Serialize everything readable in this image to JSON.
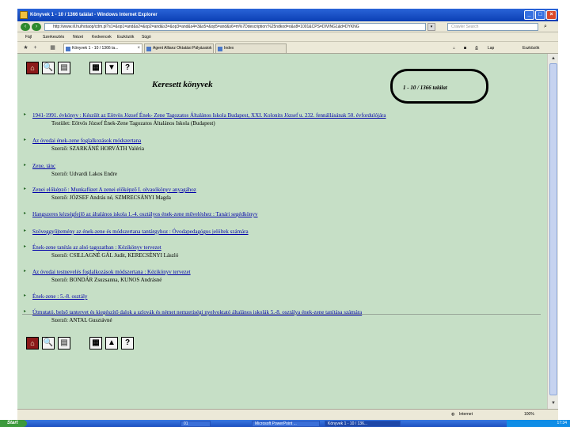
{
  "window": {
    "title": "Könyvek 1 - 10 / 1366 találat - Windows Internet Explorer",
    "minimize": "_",
    "maximize": "□",
    "close": "×"
  },
  "addressbar": {
    "url": "http://www.ill.hu/hotaop/cdm.pl?s1=&op1=and&s2=&op2=and&s3=&op3=and&s4=3&s5=&op5=and&s6=m%7Ddescription:%25ndkod=o&s8=1001&CPS=DIVING1&d=DYKNG",
    "search_placeholder": "Crawler Search",
    "search_btn": "⌕",
    "back_icon": "back-arrow-icon",
    "forward_icon": "forward-arrow-icon"
  },
  "menubar": {
    "items": [
      "Fájl",
      "Szerkesztés",
      "Nézet",
      "Kedvencek",
      "Eszközök",
      "Súgó"
    ]
  },
  "tabs": [
    {
      "label": "Könyvek 1 - 10 / 1366 ta..."
    },
    {
      "label": "Agent Allianz Oktatási Pályázatok"
    },
    {
      "label": "Index"
    }
  ],
  "commandbar": {
    "page_label": "Lap",
    "tools_label": "Eszközök"
  },
  "content": {
    "title": "Keresett könyvek",
    "hitcount": "1 - 10 / 1366 találat",
    "results": [
      {
        "link": "1941-1991. évkönyv : Készült az Eötvös József Ének- Zene Tagozatos Általános Iskola Budapest, XXI. Kolonits József u. 232. fennállásának 50. évfordulójára",
        "meta": "Testület: Eötvös József Ének-Zene Tagozatos Általános Iskola (Budapest)"
      },
      {
        "link": "Az óvodai ének-zene foglalkozások módszertana",
        "meta": "Szerző: SZARKÁNÉ HORVÁTH Valéria"
      },
      {
        "link": "Zene, tánc",
        "meta": "Szerző: Udvardi Lakos Endre"
      },
      {
        "link": "Zenei előképző : Munkafüzet A zenei előképző I. olvasókönyv anyagához",
        "meta": "Szerző: JÓZSEF András né, SZMRECSÁNYI Magda"
      },
      {
        "link": "Hangszeres kézségfejlő az általános iskola 1.-4. osztályos ének-zene műveléshez : Tanári segédkönyv",
        "meta": ""
      },
      {
        "link": "Szöveggyűjtemény az ének-zene és módszertana tantárgyhoz : Óvodapedagógus jelöltek számára",
        "meta": ""
      },
      {
        "link": "Ének-zene tanítás az alsó tagozatban : Kézikönyv tervezet",
        "meta": "Szerző: CSILLAGNÉ GÁL Judit, KERECSÉNYI László"
      },
      {
        "link": "Az óvodai testnevelés foglalkozások módszertana : Kézikönyv tervezet",
        "meta": "Szerző: BONDÁR Zsuzsanna, KUNOS Andrásné"
      },
      {
        "link": "Ének-zene : 5.-8. osztály",
        "meta": ""
      },
      {
        "link": "Útmutató, belső tantervet és kiegészítő dalok a szlovák és német nemzetiségi nyelvoktató általános iskolák 5.-8. osztálya ének-zene tanítása számára",
        "meta": "Szerző: ANTAL Gusztávné"
      }
    ]
  },
  "statusbar": {
    "zone": "Internet",
    "zoom": "100%"
  },
  "taskbar": {
    "start": "Start",
    "tasks": [
      "01",
      "Microsoft PowerPoint ...",
      "Könyvek 1 - 10 / 136..."
    ],
    "clock": "17:34"
  }
}
